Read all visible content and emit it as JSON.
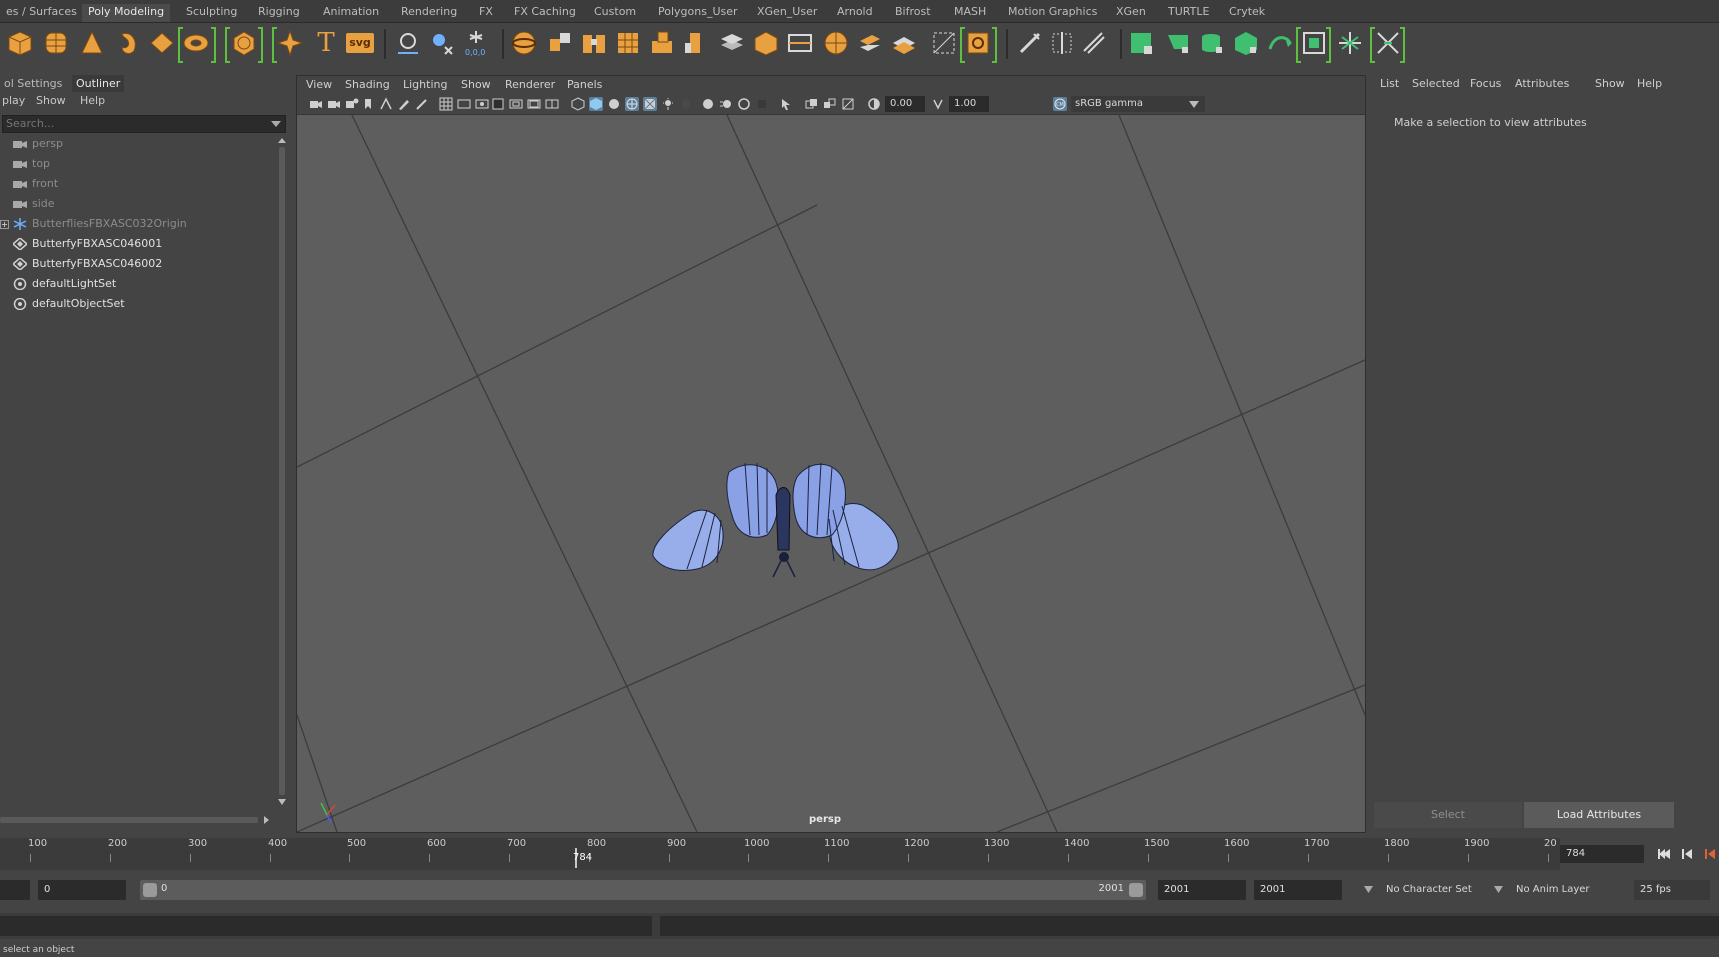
{
  "shelf": {
    "tabs": [
      "es / Surfaces",
      "Poly Modeling",
      "Sculpting",
      "Rigging",
      "Animation",
      "Rendering",
      "FX",
      "FX Caching",
      "Custom",
      "Polygons_User",
      "XGen_User",
      "Arnold",
      "Bifrost",
      "MASH",
      "Motion Graphics",
      "XGen",
      "TURTLE",
      "Crytek"
    ],
    "active_tab": "Poly Modeling",
    "icons": [
      "poly-cube-icon",
      "poly-sphere-icon",
      "poly-cone-icon",
      "poly-torus-icon",
      "poly-plane-icon",
      "poly-disc-icon",
      "platonic-solid-icon",
      "super-shape-icon",
      "type-text-icon",
      "svg-icon",
      "pivot-icon",
      "snap-icon",
      "object-center-icon",
      "combine-icon",
      "separate-icon",
      "extract-icon",
      "smooth-icon",
      "boolean-icon",
      "bridge-icon",
      "extrude-icon",
      "bevel-icon",
      "append-icon",
      "fill-hole-icon",
      "merge-icon",
      "triangulate-icon",
      "mirror-icon",
      "target-weld-icon",
      "multi-cut-icon",
      "insert-edge-loop-icon",
      "offset-edge-loop-icon",
      "uv-editor-icon",
      "planar-map-icon",
      "cylindrical-map-icon",
      "spherical-map-icon",
      "automatic-map-icon",
      "unfold-icon",
      "layout-icon",
      "symmetrize-icon",
      "sculpt-icon"
    ],
    "text_icon_glyph": "T",
    "svg_icon_text": "svg"
  },
  "outliner": {
    "tabs": [
      "ol Settings",
      "Outliner"
    ],
    "active_tab": "Outliner",
    "menu": [
      "play",
      "Show",
      "Help"
    ],
    "search_placeholder": "Search...",
    "items": [
      {
        "label": "persp",
        "type": "camera-icon",
        "dim": true
      },
      {
        "label": "top",
        "type": "camera-icon",
        "dim": true
      },
      {
        "label": "front",
        "type": "camera-icon",
        "dim": true
      },
      {
        "label": "side",
        "type": "camera-icon",
        "dim": true
      },
      {
        "label": "ButterfliesFBXASC032Origin",
        "type": "joint-icon",
        "dim": true,
        "expandable": true
      },
      {
        "label": "ButterfyFBXASC046001",
        "type": "mesh-icon",
        "dim": false
      },
      {
        "label": "ButterfyFBXASC046002",
        "type": "mesh-icon",
        "dim": false
      },
      {
        "label": "defaultLightSet",
        "type": "set-icon",
        "dim": false
      },
      {
        "label": "defaultObjectSet",
        "type": "set-icon",
        "dim": false
      }
    ]
  },
  "viewport": {
    "menu": [
      "View",
      "Shading",
      "Lighting",
      "Show",
      "Renderer",
      "Panels"
    ],
    "exposure": "0.00",
    "gamma": "1.00",
    "color_space": "sRGB gamma",
    "camera_label": "persp"
  },
  "attribute_editor": {
    "menu": [
      "List",
      "Selected",
      "Focus",
      "Attributes",
      "Show",
      "Help"
    ],
    "hint": "Make a selection to view attributes",
    "select_label": "Select",
    "load_label": "Load Attributes"
  },
  "timeline": {
    "ticks": [
      "100",
      "200",
      "300",
      "400",
      "500",
      "600",
      "700",
      "800",
      "900",
      "1000",
      "1100",
      "1200",
      "1300",
      "1400",
      "1500",
      "1600",
      "1700",
      "1800",
      "1900",
      "20"
    ],
    "current_frame_marker": "784",
    "current_frame": "784"
  },
  "range": {
    "start_field": "0",
    "slider_start": "0",
    "slider_end": "2001",
    "end_field": "2001",
    "end_field2": "2001",
    "character_set": "No Character Set",
    "anim_layer": "No Anim Layer",
    "fps": "25 fps"
  },
  "help_line": "select an object",
  "colors": {
    "bg": "#444444",
    "viewport_bg": "#5e5e5e",
    "accent": "#5d7f9a",
    "shelf_green": "#5fbf3f",
    "shelf_orange": "#e8a040",
    "butterfly_blue": "#8ea3e6"
  }
}
